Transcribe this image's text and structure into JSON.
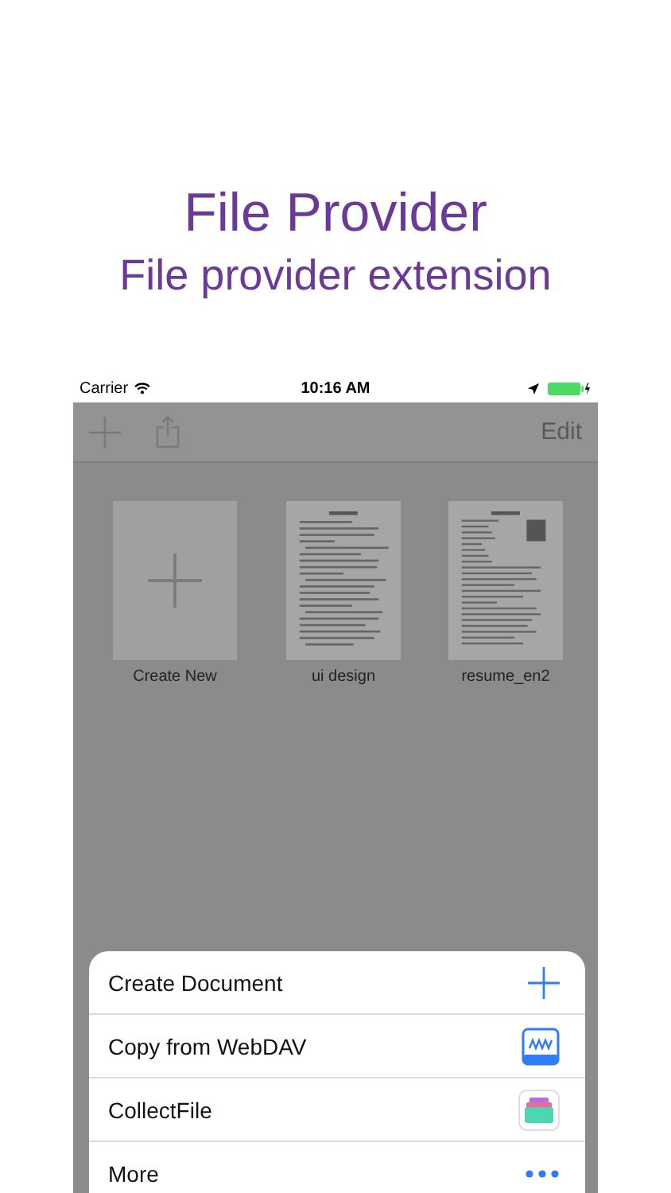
{
  "headline": {
    "title": "File Provider",
    "subtitle": "File provider extension"
  },
  "status_bar": {
    "carrier": "Carrier",
    "time": "10:16 AM"
  },
  "toolbar": {
    "edit": "Edit"
  },
  "files": [
    {
      "kind": "new",
      "name": "Create New"
    },
    {
      "kind": "document",
      "name": "ui design"
    },
    {
      "kind": "resume",
      "name": "resume_en2"
    }
  ],
  "menu": [
    {
      "kind": "plus",
      "label": "Create Document"
    },
    {
      "kind": "webdav",
      "label": "Copy from WebDAV"
    },
    {
      "kind": "app",
      "label": "CollectFile"
    },
    {
      "kind": "more",
      "label": "More"
    }
  ]
}
